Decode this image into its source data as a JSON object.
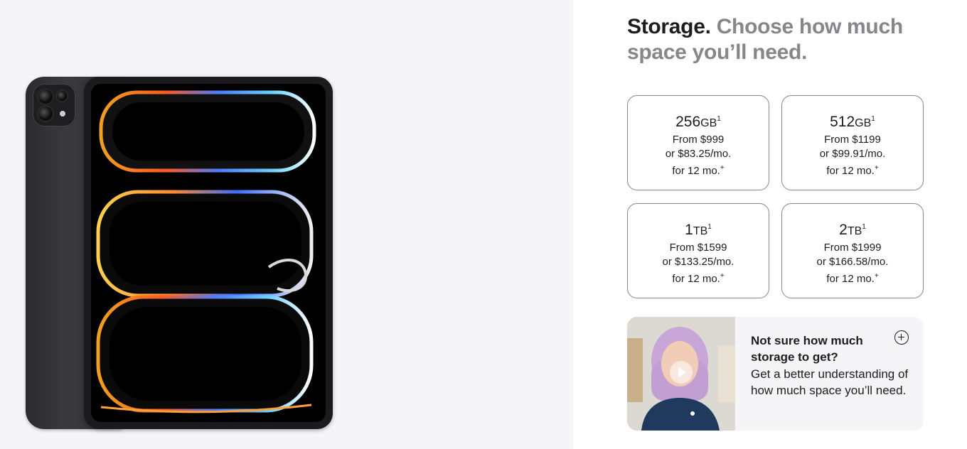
{
  "heading": {
    "strong": "Storage.",
    "muted": "Choose how much space you’ll need."
  },
  "storage_options": [
    {
      "capacity_number": "256",
      "capacity_unit": "GB",
      "footnote": "1",
      "price": "From $999",
      "monthly": "or $83.25/mo.",
      "term": "for 12 mo.",
      "term_mark": "+"
    },
    {
      "capacity_number": "512",
      "capacity_unit": "GB",
      "footnote": "1",
      "price": "From $1199",
      "monthly": "or $99.91/mo.",
      "term": "for 12 mo.",
      "term_mark": "+"
    },
    {
      "capacity_number": "1",
      "capacity_unit": "TB",
      "footnote": "1",
      "price": "From $1599",
      "monthly": "or $133.25/mo.",
      "term": "for 12 mo.",
      "term_mark": "+"
    },
    {
      "capacity_number": "2",
      "capacity_unit": "TB",
      "footnote": "1",
      "price": "From $1999",
      "monthly": "or $166.58/mo.",
      "term": "for 12 mo.",
      "term_mark": "+"
    }
  ],
  "help_card": {
    "title": "Not sure how much storage to get?",
    "body": "Get a better understanding of how much space you’ll need.",
    "icon": "plus-circle-icon",
    "video_icon": "play-icon"
  },
  "colors": {
    "text": "#1d1d1f",
    "muted": "#86868b",
    "panel": "#f5f5f7",
    "border": "#86868b"
  }
}
